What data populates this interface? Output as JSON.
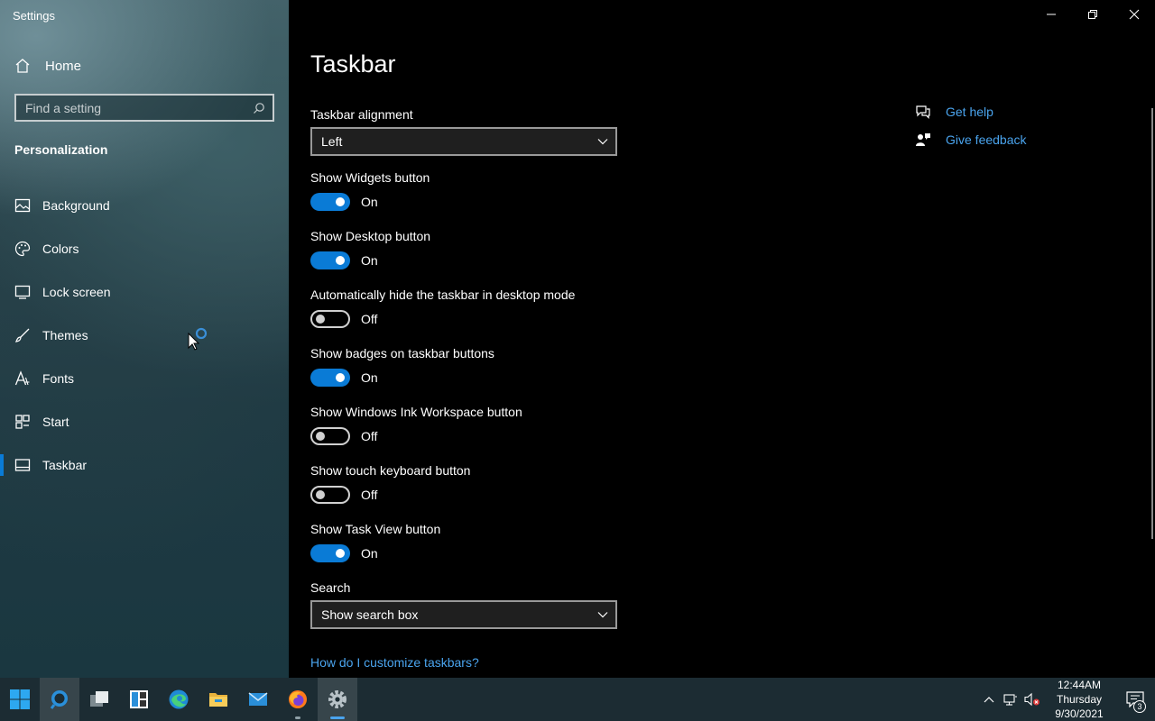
{
  "window": {
    "title": "Settings"
  },
  "sidebar": {
    "home_label": "Home",
    "search_placeholder": "Find a setting",
    "section_title": "Personalization",
    "items": [
      {
        "label": "Background",
        "icon": "picture-icon"
      },
      {
        "label": "Colors",
        "icon": "palette-icon"
      },
      {
        "label": "Lock screen",
        "icon": "monitor-icon"
      },
      {
        "label": "Themes",
        "icon": "brush-icon"
      },
      {
        "label": "Fonts",
        "icon": "font-icon"
      },
      {
        "label": "Start",
        "icon": "start-tiles-icon"
      },
      {
        "label": "Taskbar",
        "icon": "taskbar-icon",
        "active": true
      }
    ]
  },
  "main": {
    "page_title": "Taskbar",
    "alignment": {
      "label": "Taskbar alignment",
      "value": "Left"
    },
    "toggles": [
      {
        "label": "Show Widgets button",
        "state": "On"
      },
      {
        "label": "Show Desktop button",
        "state": "On"
      },
      {
        "label": "Automatically hide the taskbar in desktop mode",
        "state": "Off"
      },
      {
        "label": "Show badges on taskbar buttons",
        "state": "On"
      },
      {
        "label": "Show Windows Ink Workspace button",
        "state": "Off"
      },
      {
        "label": "Show touch keyboard button",
        "state": "Off"
      },
      {
        "label": "Show Task View button",
        "state": "On"
      }
    ],
    "search": {
      "label": "Search",
      "value": "Show search box"
    },
    "customize_link": "How do I customize taskbars?",
    "help": {
      "get_help": "Get help",
      "give_feedback": "Give feedback"
    }
  },
  "taskbar": {
    "apps": [
      "start-icon",
      "search-icon",
      "task-view-icon",
      "widgets-icon",
      "edge-icon",
      "file-explorer-icon",
      "mail-icon",
      "firefox-icon",
      "settings-icon"
    ],
    "clock": {
      "time": "12:44AM",
      "day": "Thursday",
      "date": "9/30/2021"
    },
    "notification_count": "3"
  },
  "colors": {
    "accent": "#0a7bd6",
    "link": "#4aa4ee",
    "taskbar": "#1c2c33"
  }
}
